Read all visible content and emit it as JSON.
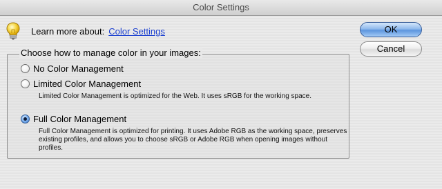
{
  "window": {
    "title": "Color Settings"
  },
  "help": {
    "prefix": "Learn more about:",
    "link_label": "Color Settings"
  },
  "buttons": {
    "ok_label": "OK",
    "cancel_label": "Cancel"
  },
  "group": {
    "legend": "Choose how to manage color in your images:",
    "options": [
      {
        "label": "No Color Management",
        "checked": false,
        "description": ""
      },
      {
        "label": "Limited Color Management",
        "checked": false,
        "description": "Limited Color Management is optimized for the Web. It uses sRGB for the working space."
      },
      {
        "label": "Full Color Management",
        "checked": true,
        "description_lines": [
          "Full Color Management is optimized for printing. It uses Adobe RGB as the working space, preserves",
          "existing profiles, and allows you to choose sRGB or Adobe RGB when opening images without",
          "profiles."
        ]
      }
    ]
  },
  "icons": {
    "help": "lightbulb-icon"
  },
  "colors": {
    "link": "#1a3fd0",
    "default_button": "#5d95de"
  }
}
